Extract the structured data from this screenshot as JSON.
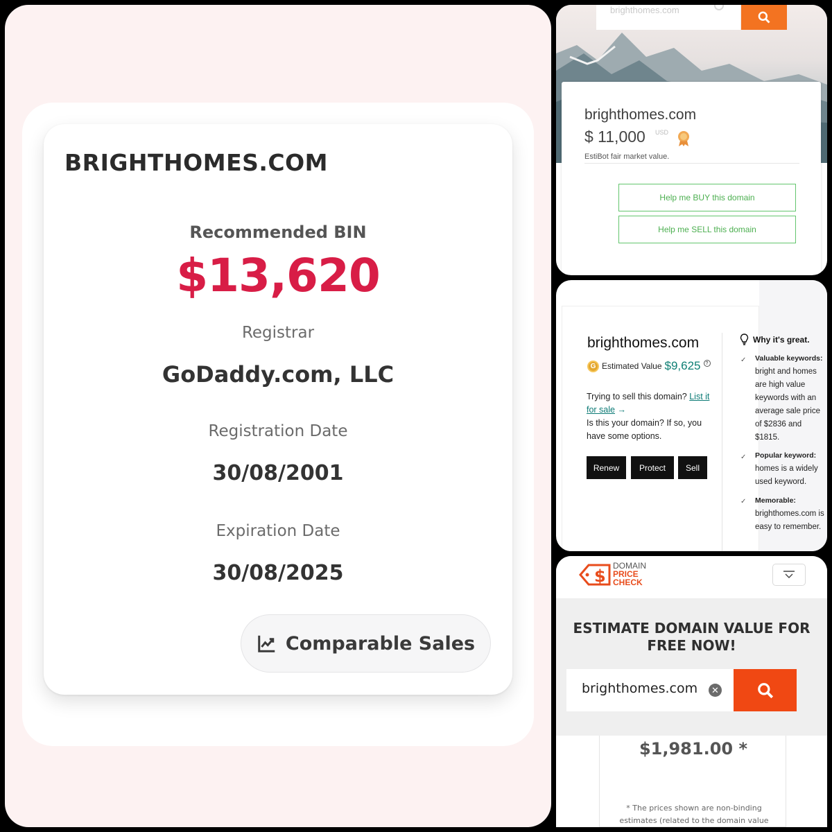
{
  "left": {
    "domain_title": "BRIGHTHOMES.COM",
    "recommended_label": "Recommended BIN",
    "recommended_price": "$13,620",
    "registrar_label": "Registrar",
    "registrar_value": "GoDaddy.com, LLC",
    "registration_label": "Registration Date",
    "registration_value": "30/08/2001",
    "expiration_label": "Expiration Date",
    "expiration_value": "30/08/2025",
    "comparable_sales_label": "Comparable Sales",
    "price_color": "#d81d46"
  },
  "estibot": {
    "search_placeholder": "brighthomes.com",
    "domain": "brighthomes.com",
    "price": "$ 11,000",
    "currency": "USD",
    "subtitle": "EstiBot fair market value.",
    "buy_button": "Help me BUY this domain",
    "sell_button": "Help me SELL this domain",
    "accent": "#f37321",
    "button_color": "#4caf50"
  },
  "godaddy": {
    "domain": "brighthomes.com",
    "estimated_label": "Estimated Value",
    "estimated_value": "$9,625",
    "coin_letter": "G",
    "help_glyph": "?",
    "sell_prompt": "Trying to sell this domain?",
    "list_link": "List it for sale",
    "arrow": "→",
    "own_prompt": "Is this your domain? If so, you have some options.",
    "buttons": [
      "Renew",
      "Protect",
      "Sell"
    ],
    "why_title": "Why it's great.",
    "reasons": [
      {
        "title": "Valuable keywords:",
        "text": "bright and homes are high value keywords with an average sale price of $2836 and $1815."
      },
      {
        "title": "Popular keyword:",
        "text": "homes is a widely used keyword."
      },
      {
        "title": "Memorable:",
        "text": "brighthomes.com is easy to remember."
      }
    ],
    "check_glyph": "✓"
  },
  "pricecheck": {
    "logo_line1": "DOMAIN",
    "logo_line2": "PRICE",
    "logo_line3": "CHECK",
    "headline": "ESTIMATE DOMAIN VALUE FOR FREE NOW!",
    "input_value": "brighthomes.com",
    "clear_glyph": "✕",
    "price": "$1,981.00 *",
    "note": "* The prices shown are non-binding estimates (related to the domain value",
    "accent": "#f04813"
  }
}
